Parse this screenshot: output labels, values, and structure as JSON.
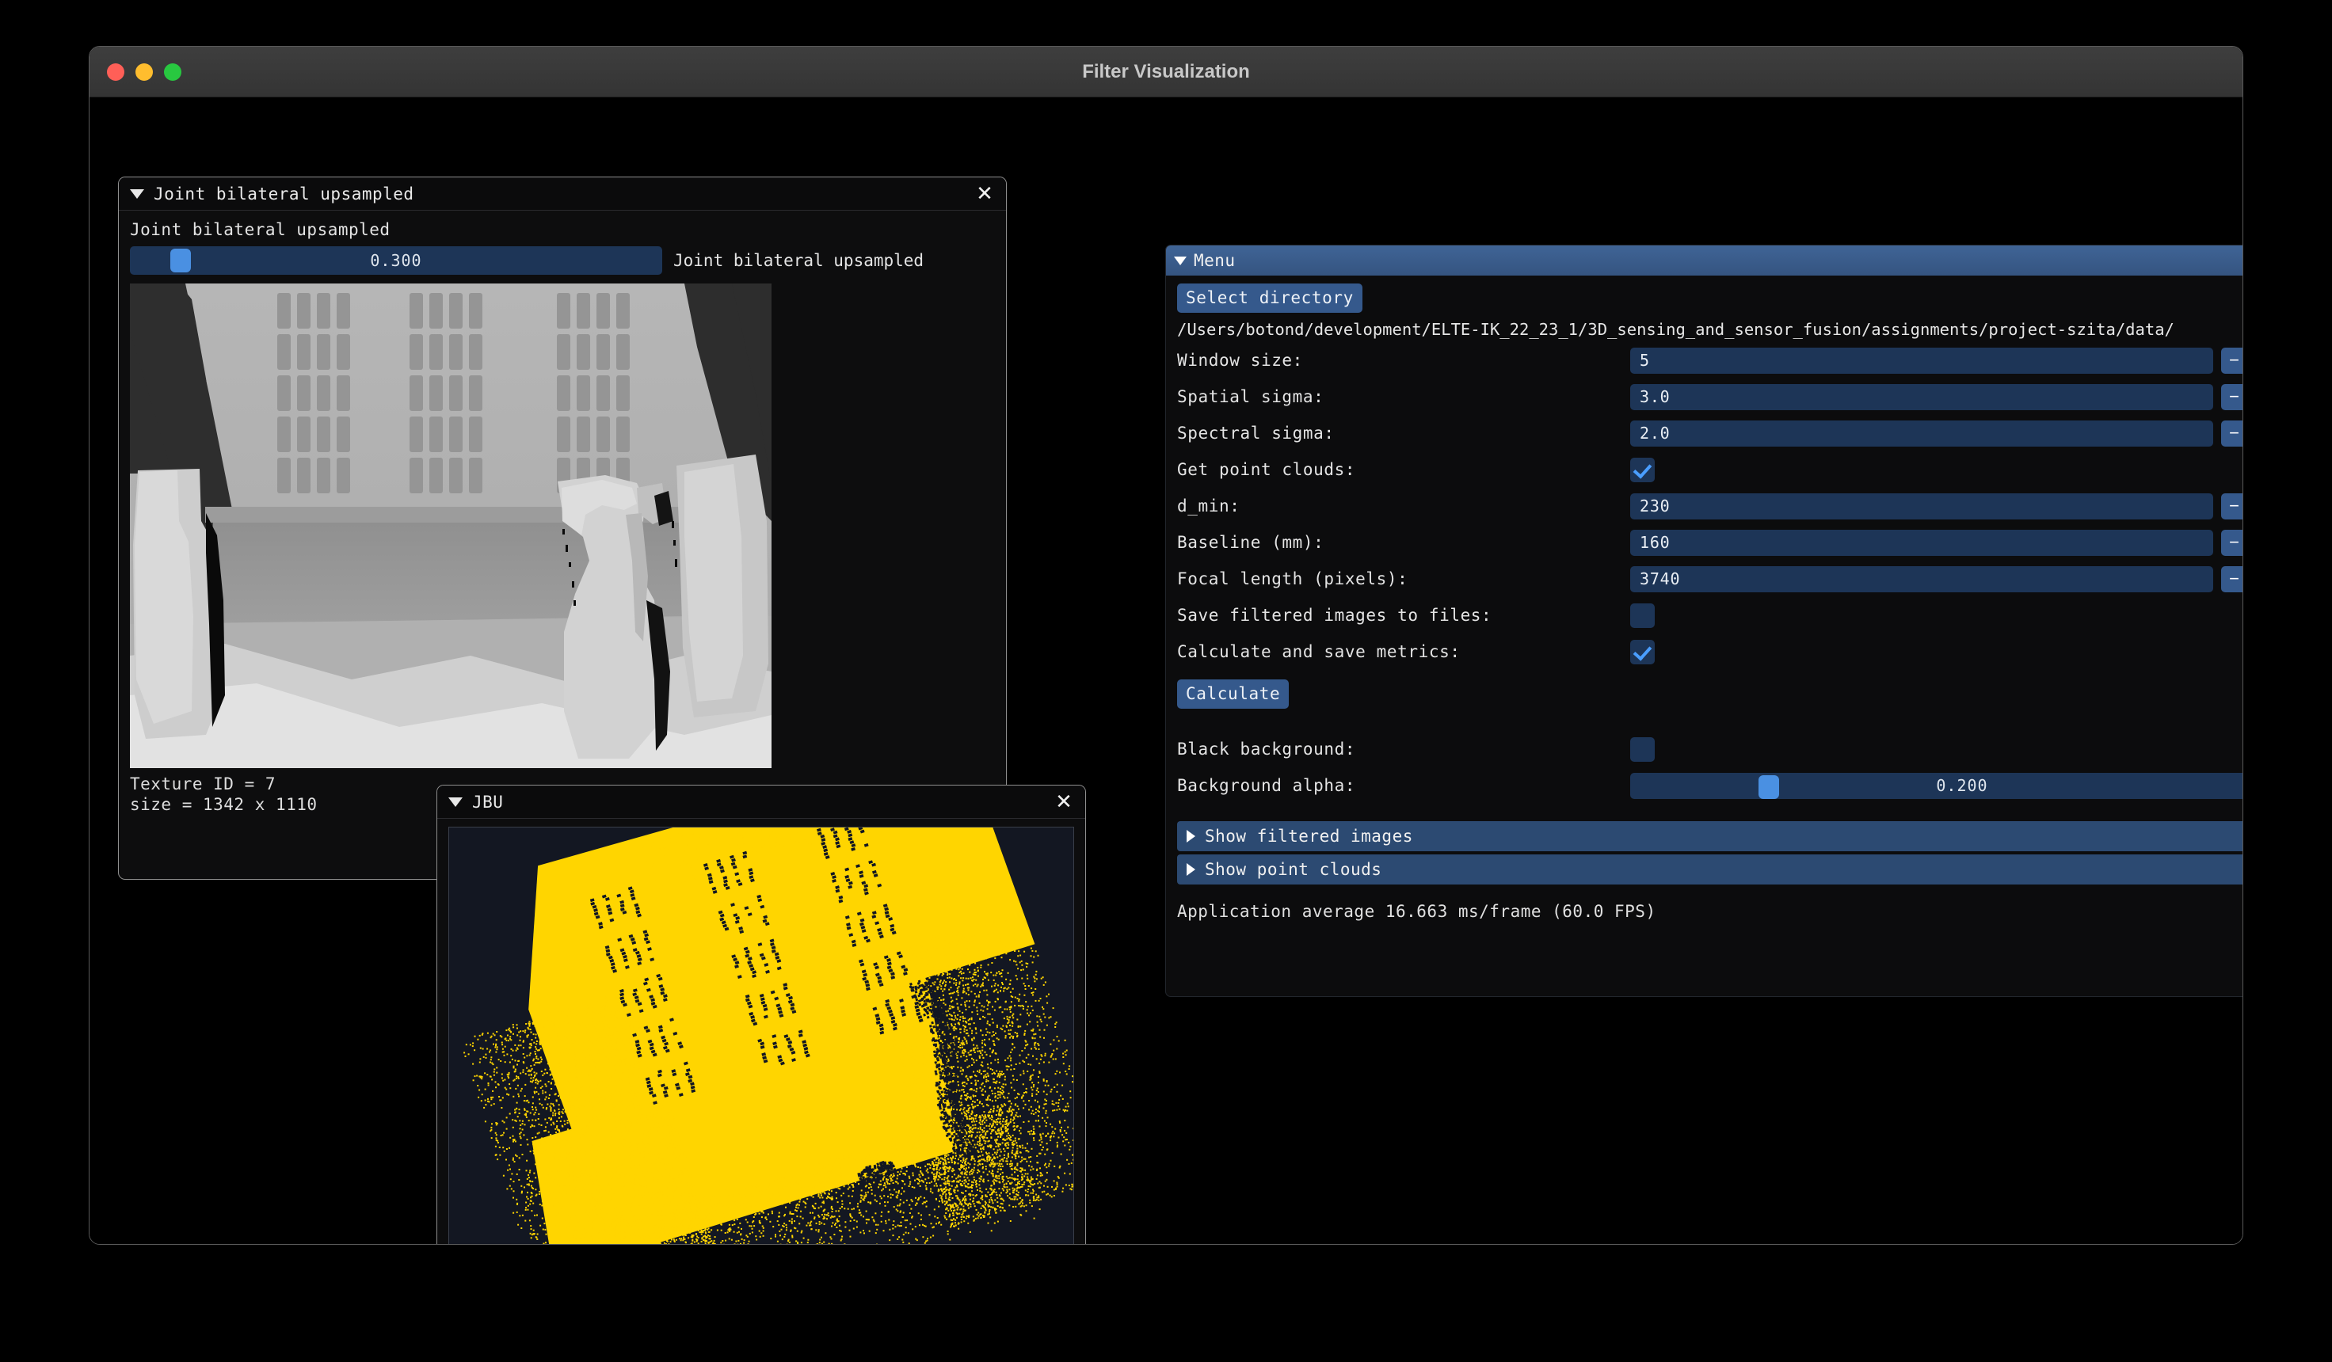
{
  "os_window": {
    "title": "Filter Visualization",
    "traffic_lights": [
      "close",
      "minimize",
      "maximize"
    ]
  },
  "upsampled_window": {
    "title": "Joint bilateral upsampled",
    "close_label": "✕",
    "slider_label": "Joint bilateral upsampled",
    "slider_value": "0.300",
    "slider_value_num": 0.3,
    "slider_side_label": "Joint bilateral upsampled",
    "texture_id_line": "Texture ID = 7",
    "size_line": "size = 1342 x 1110"
  },
  "jbu_window": {
    "title": "JBU",
    "close_label": "✕",
    "point_color": "#FFD500",
    "background_color": "#131722"
  },
  "menu": {
    "header": "Menu",
    "select_directory_label": "Select directory",
    "path": "/Users/botond/development/ELTE-IK_22_23_1/3D_sensing_and_sensor_fusion/assignments/project-szita/data/",
    "fields": [
      {
        "label": "Window size:",
        "value": "5",
        "type": "stepper"
      },
      {
        "label": "Spatial sigma:",
        "value": "3.0",
        "type": "stepper"
      },
      {
        "label": "Spectral sigma:",
        "value": "2.0",
        "type": "stepper"
      },
      {
        "label": "Get point clouds:",
        "value": "",
        "type": "checkbox",
        "checked": true
      },
      {
        "label": "d_min:",
        "value": "230",
        "type": "stepper"
      },
      {
        "label": "Baseline (mm):",
        "value": "160",
        "type": "stepper"
      },
      {
        "label": "Focal length (pixels):",
        "value": "3740",
        "type": "stepper"
      },
      {
        "label": "Save filtered images to files:",
        "value": "",
        "type": "checkbox",
        "checked": false
      },
      {
        "label": "Calculate and save metrics:",
        "value": "",
        "type": "checkbox",
        "checked": true
      }
    ],
    "calculate_label": "Calculate",
    "black_background_label": "Black background:",
    "black_background_checked": false,
    "background_alpha_label": "Background alpha:",
    "background_alpha_value": "0.200",
    "background_alpha_num": 0.2,
    "show_filtered_images_label": "Show filtered images",
    "show_point_clouds_label": "Show point clouds",
    "fps_line": "Application average 16.663 ms/frame (60.0 FPS)",
    "stepper_minus": "−",
    "stepper_plus": "+",
    "accent_color": "#35598c",
    "input_color": "#1d3557",
    "header_color": "#3f6496",
    "checkmark_color": "#4a9eff"
  }
}
